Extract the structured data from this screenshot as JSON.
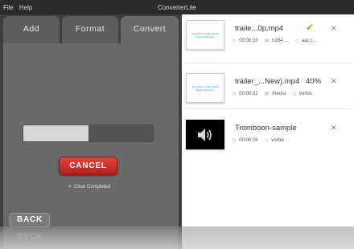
{
  "window": {
    "title": "ConverterLite",
    "menu": [
      "File",
      "Help"
    ]
  },
  "tabs": [
    {
      "label": "Add"
    },
    {
      "label": "Format"
    },
    {
      "label": "Convert",
      "active": true
    }
  ],
  "convert_panel": {
    "progress_fraction": 0.5,
    "cancel_label": "CANCEL",
    "clear_label": "Clear Completed",
    "back_label": "BACK"
  },
  "queue": [
    {
      "name": "traile...0p.mp4",
      "status": "✔",
      "status_type": "done",
      "duration": "00:00:33",
      "video_codec": "h264 ...",
      "audio_codec": "aac (...",
      "thumb_text": "Test Source Video World Region Wonders"
    },
    {
      "name": "trailer_...New).mp4",
      "status": "40%",
      "status_type": "progress",
      "duration": "00:00:32",
      "video_codec": "theora",
      "audio_codec": "vorbis",
      "thumb_text": "Test Source Video World Region Wonders"
    },
    {
      "name": "Tromboon-sample",
      "status": "",
      "status_type": "pending",
      "duration": "00:00:28",
      "video_codec": "",
      "audio_codec": "vorbis",
      "thumb_text": ""
    }
  ],
  "colors": {
    "panel": "#6a6a6a",
    "cancel": "#d0302b",
    "done": "#6cc21f"
  },
  "icons": {
    "remove": "close-icon",
    "duration": "clock-icon",
    "video": "film-icon",
    "audio": "speaker-icon"
  }
}
